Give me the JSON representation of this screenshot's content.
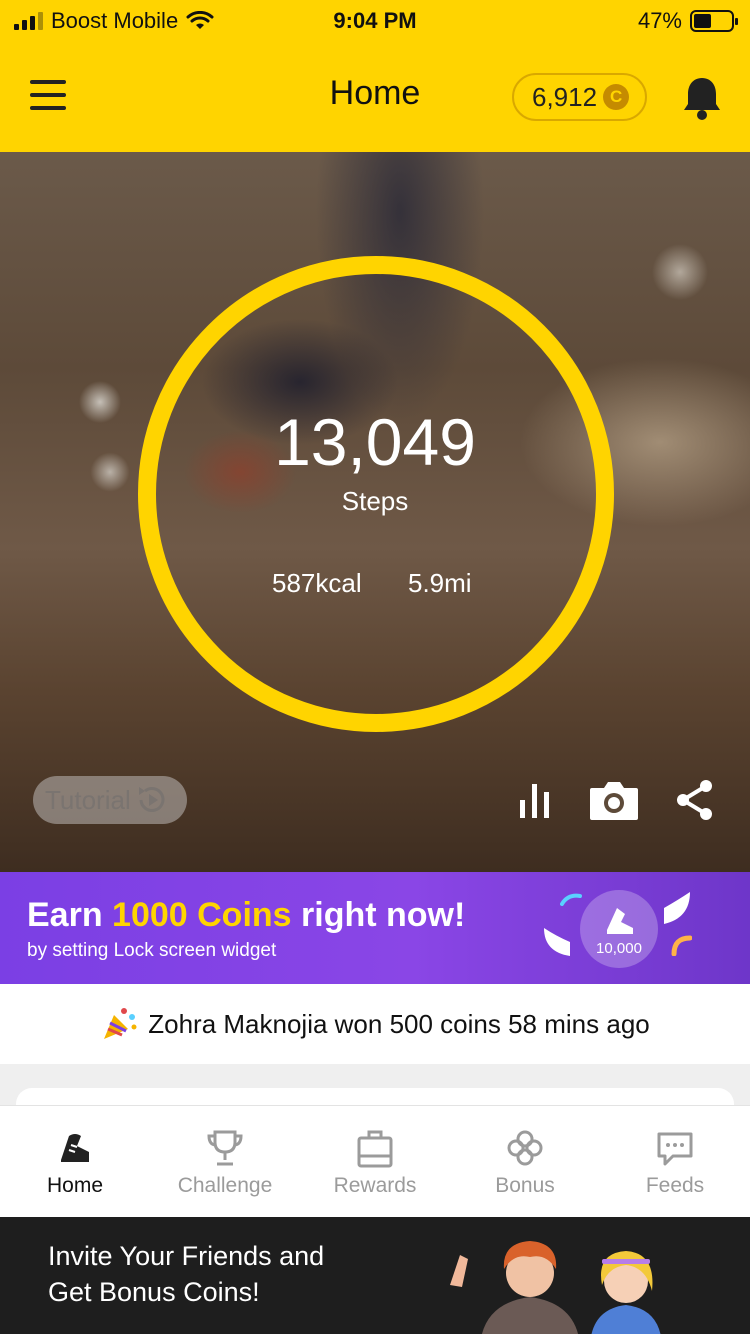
{
  "status_bar": {
    "carrier": "Boost Mobile",
    "time": "9:04 PM",
    "battery": "47%",
    "battery_level": 0.47
  },
  "header": {
    "title": "Home",
    "coins": "6,912",
    "coin_symbol": "C",
    "menu_icon": "hamburger-icon",
    "bell_icon": "bell-icon"
  },
  "hero": {
    "steps": "13,049",
    "steps_label": "Steps",
    "calories": "587kcal",
    "distance": "5.9mi",
    "tutorial_label": "Tutorial",
    "ring_color": "#ffd400",
    "icons": [
      "stats-icon",
      "camera-icon",
      "share-icon"
    ]
  },
  "promo": {
    "title_pre": "Earn ",
    "title_highlight": "1000 Coins",
    "title_post": " right now!",
    "subtitle": "by setting Lock screen widget",
    "badge_text": "10,000",
    "highlight_color": "#ffd400"
  },
  "ticker": {
    "text": "Zohra Maknojia won 500 coins 58 mins ago"
  },
  "tabs": [
    {
      "label": "Home",
      "icon": "shoe-icon",
      "active": true
    },
    {
      "label": "Challenge",
      "icon": "trophy-icon",
      "active": false
    },
    {
      "label": "Rewards",
      "icon": "shopping-bag-icon",
      "active": false
    },
    {
      "label": "Bonus",
      "icon": "clover-icon",
      "active": false
    },
    {
      "label": "Feeds",
      "icon": "chat-bubble-icon",
      "active": false
    }
  ],
  "invite": {
    "line1": "Invite Your Friends and",
    "line2": "Get Bonus Coins!"
  },
  "colors": {
    "brand_yellow": "#ffd400",
    "promo_purple": "#7b3fe4"
  }
}
